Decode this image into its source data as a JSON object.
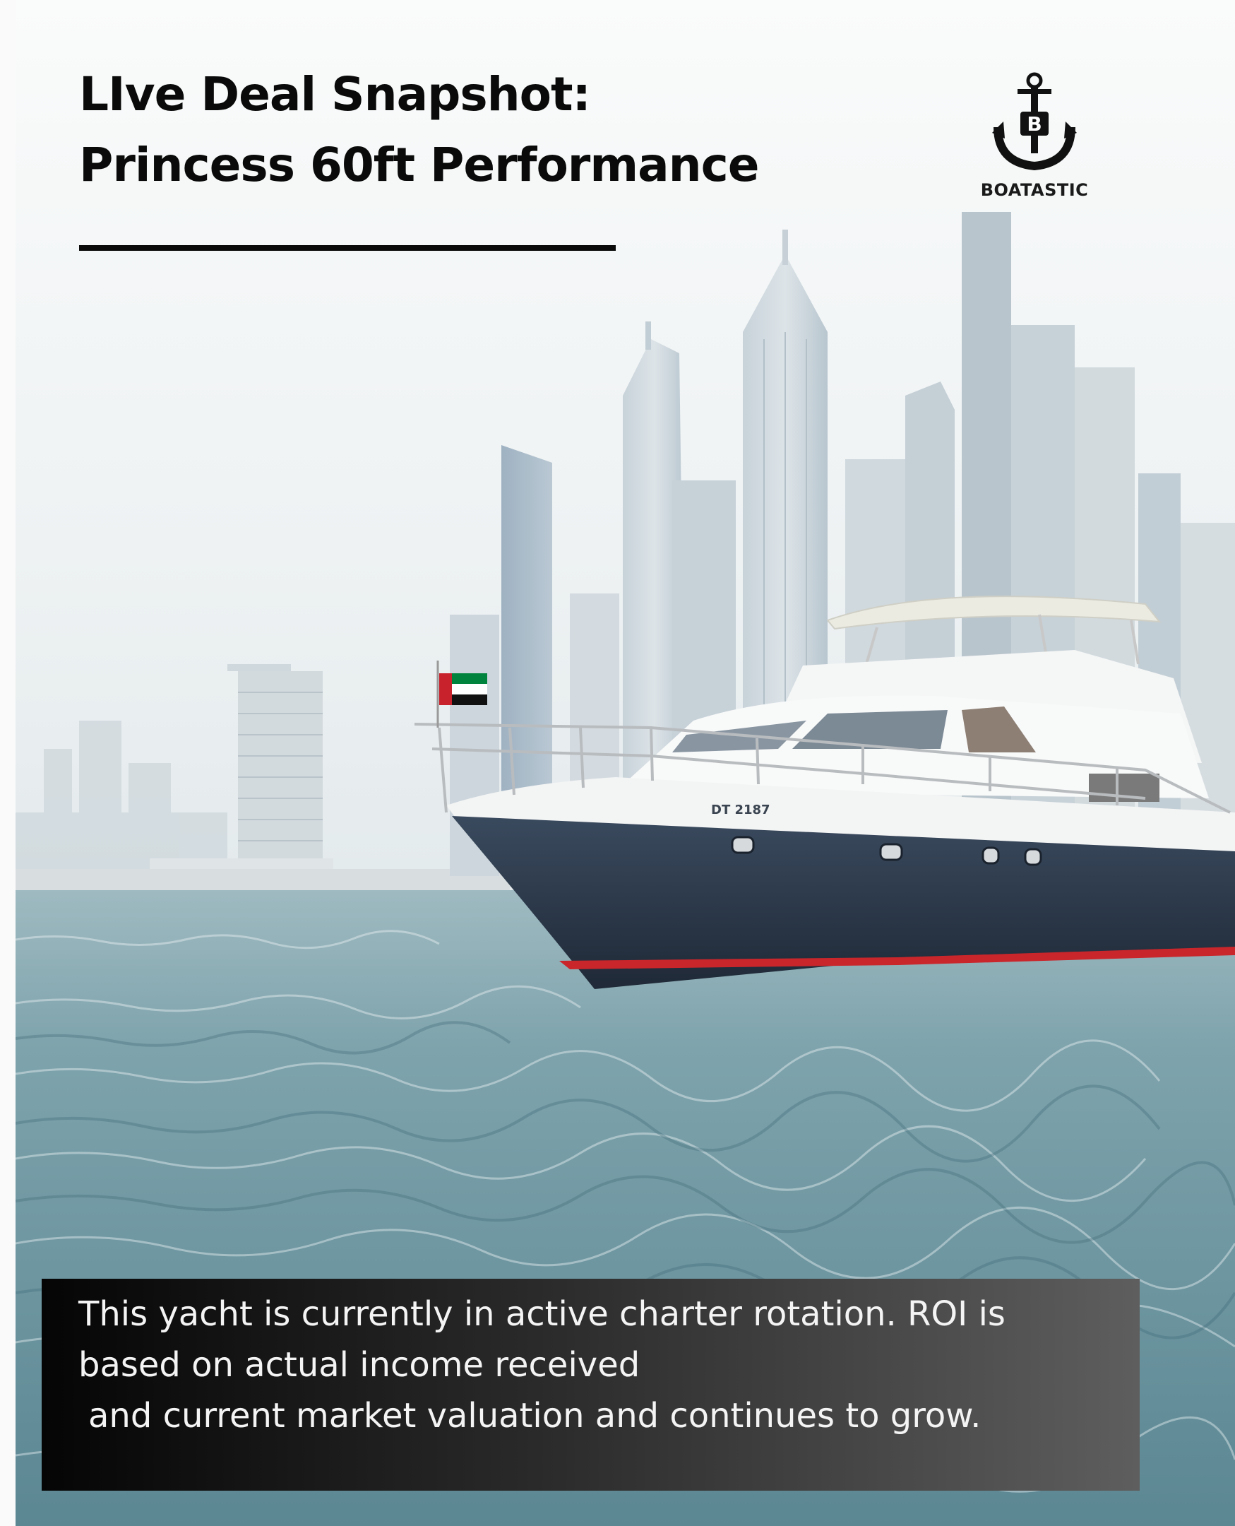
{
  "header": {
    "title_line1": "LIve Deal Snapshot:",
    "title_line2": "Princess 60ft Performance"
  },
  "logo": {
    "text": "BOATASTIC",
    "icon": "anchor-icon"
  },
  "photo": {
    "boat_registration": "DT 2187"
  },
  "caption": {
    "line1": "This yacht is currently in active charter rotation. ROI is",
    "line2": "based on actual income received",
    "line3": "and current market valuation and continues to grow."
  },
  "colors": {
    "title": "#0a0a0a",
    "caption_bg_start": "#050505",
    "caption_bg_end": "#5e5e5e",
    "caption_text": "#f4f4f4",
    "sea": "#5f8e9a",
    "sky": "#f1f4f5",
    "hull": "#2c3a4c",
    "boot_stripe": "#c9262b"
  }
}
